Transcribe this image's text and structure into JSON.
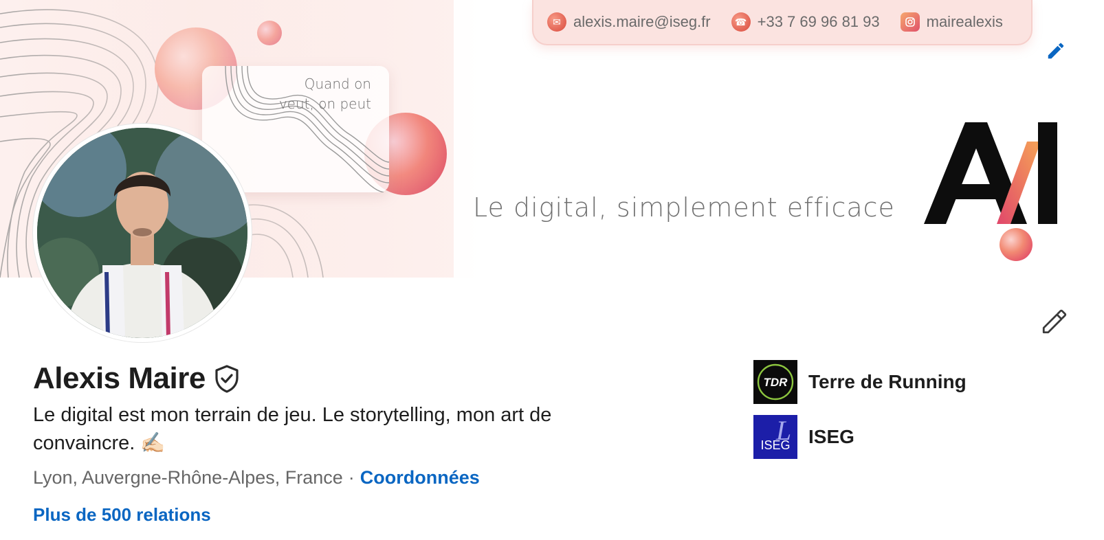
{
  "banner": {
    "contacts": [
      {
        "icon": "mail-icon",
        "text": "alexis.maire@iseg.fr"
      },
      {
        "icon": "phone-icon",
        "text": "+33 7 69 96 81 93"
      },
      {
        "icon": "instagram-icon",
        "text": "mairealexis"
      }
    ],
    "quote": "Quand on veut, on peut",
    "tagline": "Le digital, simplement efficace",
    "logo_text": "AM",
    "accent_color": "#e8604f"
  },
  "profile": {
    "name": "Alexis Maire",
    "verified_icon": "shield-check-icon",
    "headline": "Le digital est mon terrain de jeu. Le storytelling, mon art de convaincre. ✍🏻",
    "location": "Lyon, Auvergne-Rhône-Alpes, France",
    "separator": "·",
    "contact_link": "Coordonnées",
    "relations": "Plus de 500 relations",
    "link_color": "#0a66c2"
  },
  "organizations": [
    {
      "name": "Terre de Running",
      "logo_text": "TDR"
    },
    {
      "name": "ISEG",
      "logo_text": "ISEG"
    }
  ],
  "actions": {
    "edit_banner_icon": "pencil-icon",
    "edit_profile_icon": "pencil-icon"
  }
}
